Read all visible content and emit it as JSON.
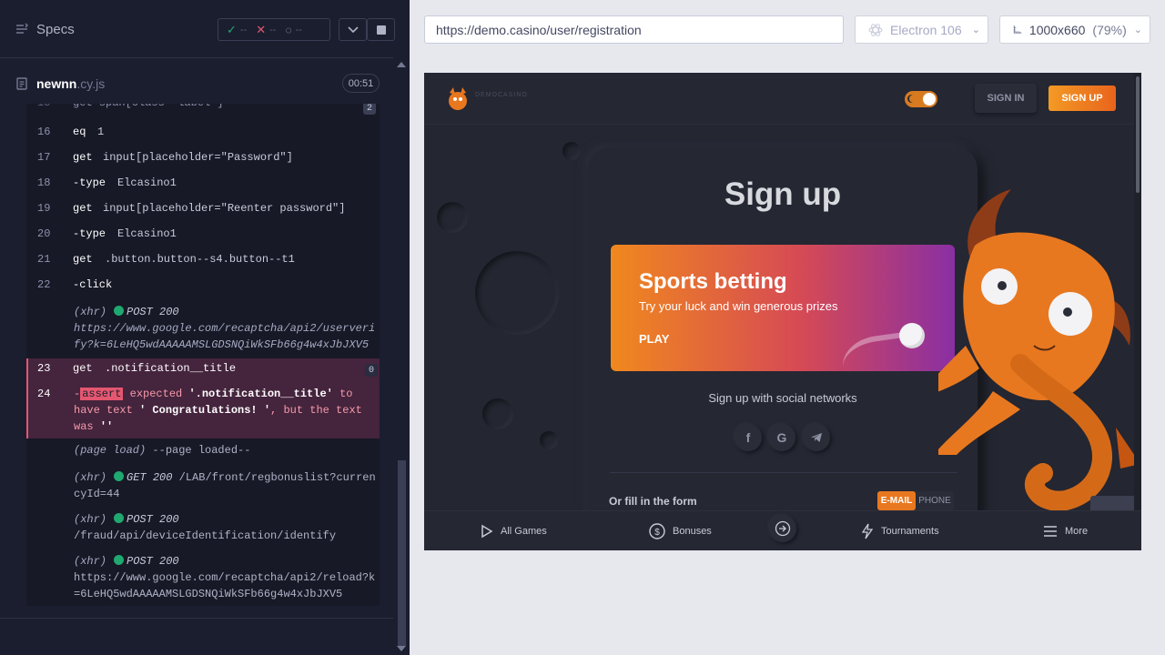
{
  "reporter": {
    "specs_title": "Specs",
    "stats": {
      "passed": "--",
      "failed": "--",
      "pending": "--"
    },
    "file": {
      "name": "newnn",
      "ext": ".cy.js",
      "duration": "00:51"
    },
    "commands": [
      {
        "num": "16",
        "name": "eq",
        "arg": "1"
      },
      {
        "num": "17",
        "name": "get",
        "arg": "input[placeholder=\"Password\"]"
      },
      {
        "num": "18",
        "name": "-type",
        "arg": "Elcasino1"
      },
      {
        "num": "19",
        "name": "get",
        "arg": "input[placeholder=\"Reenter password\"]"
      },
      {
        "num": "20",
        "name": "-type",
        "arg": "Elcasino1"
      },
      {
        "num": "21",
        "name": "get",
        "arg": ".button.button--s4.button--t1"
      },
      {
        "num": "22",
        "name": "-click",
        "arg": ""
      }
    ],
    "xhr1": {
      "label": "(xhr)",
      "method": "POST 200",
      "url": "https://www.google.com/recaptcha/api2/userverify?k=6LeHQ5wdAAAAAMSLGDSNQiWkSFb66g4w4xJbJXV5"
    },
    "error": {
      "cmd23": {
        "num": "23",
        "name": "get",
        "arg": ".notification__title",
        "count": "0"
      },
      "cmd24": {
        "num": "24",
        "prefix": "-",
        "assert": "assert",
        "t1": " expected ",
        "sel": "'.notification__title'",
        "t2": " to have text ",
        "txt": "' Congratulations! '",
        "t3": ", but the text was ",
        "empty": "''"
      }
    },
    "page_load": {
      "label": "(page load)",
      "text": "--page loaded--"
    },
    "xhr2": {
      "label": "(xhr)",
      "method": "GET 200",
      "url": "/LAB/front/regbonuslist?currencyId=44"
    },
    "xhr3": {
      "label": "(xhr)",
      "method": "POST 200",
      "url": "/fraud/api/deviceIdentification/identify"
    },
    "xhr4": {
      "label": "(xhr)",
      "method": "POST 200",
      "url": "https://www.google.com/recaptcha/api2/reload?k=6LeHQ5wdAAAAAMSLGDSNQiWkSFb66g4w4xJbJXV5"
    }
  },
  "browser": {
    "url": "https://demo.casino/user/registration",
    "browser_name": "Electron 106",
    "viewport": "1000x660",
    "zoom": "(79%)"
  },
  "app": {
    "logo_text": "DEMOCASINO",
    "signin": "SIGN IN",
    "signup": "SIGN UP",
    "page_title": "Sign up",
    "banner": {
      "title": "Sports betting",
      "subtitle": "Try your luck and win generous prizes",
      "cta": "PLAY"
    },
    "social_label": "Sign up with social networks",
    "social": [
      "f",
      "G",
      "telegram"
    ],
    "form_label": "Or fill in the form",
    "method_switch": {
      "email": "E-MAIL",
      "phone": "PHONE"
    },
    "bottom_nav": {
      "games": "All Games",
      "bonuses": "Bonuses",
      "tournaments": "Tournaments",
      "more": "More"
    }
  },
  "colors": {
    "accent": "#e8781f",
    "pass": "#1fa971",
    "fail": "#e45770"
  }
}
